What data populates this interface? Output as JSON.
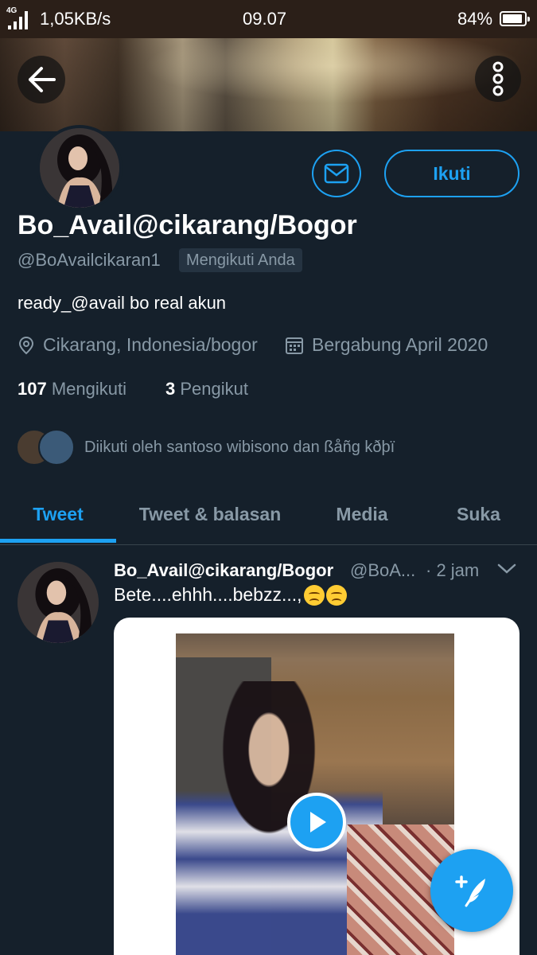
{
  "status_bar": {
    "network": "4G",
    "speed": "1,05KB/s",
    "time": "09.07",
    "battery": "84%"
  },
  "header": {
    "back_icon": "arrow-left-icon",
    "more_icon": "vertical-dots-icon"
  },
  "profile": {
    "display_name": "Bo_Avail@cikarang/Bogor",
    "handle": "@BoAvailcikaran1",
    "follows_you_badge": "Mengikuti Anda",
    "bio": "ready_@avail bo real akun",
    "location": "Cikarang, Indonesia/bogor",
    "joined": "Bergabung April 2020",
    "following_count": "107",
    "following_label": "Mengikuti",
    "followers_count": "3",
    "followers_label": "Pengikut",
    "followed_by": "Diikuti oleh santoso wibisono dan ßåñg kðþï",
    "follow_button": "Ikuti"
  },
  "tabs": [
    {
      "label": "Tweet",
      "active": true
    },
    {
      "label": "Tweet & balasan",
      "active": false
    },
    {
      "label": "Media",
      "active": false
    },
    {
      "label": "Suka",
      "active": false
    }
  ],
  "tweet": {
    "author_name": "Bo_Avail@cikarang/Bogor",
    "author_handle": "@BoA...",
    "time": "· 2 jam",
    "text": "Bete....ehhh....bebzz...,"
  },
  "colors": {
    "accent": "#1da1f2",
    "background": "#15202b",
    "secondary_text": "#8899a6"
  }
}
